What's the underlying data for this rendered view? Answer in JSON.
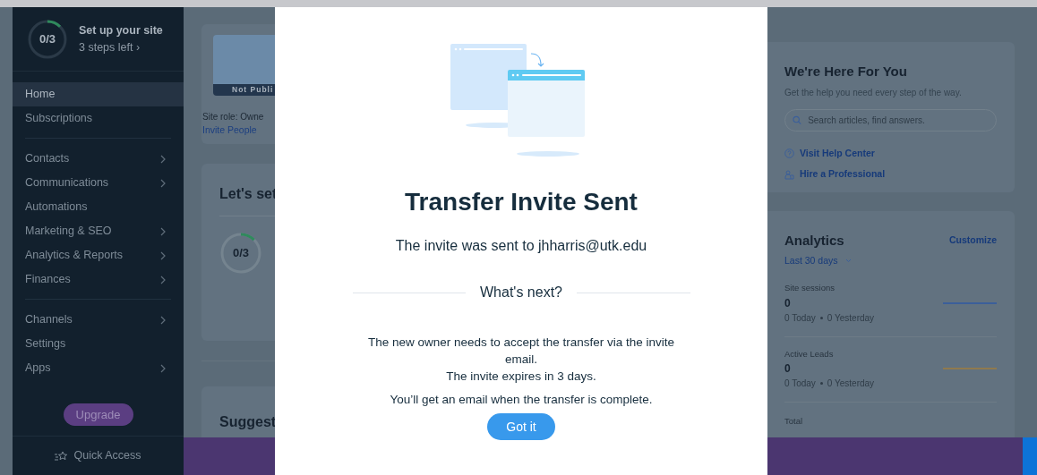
{
  "sidebar": {
    "setup": {
      "progress": "0/3",
      "title": "Set up your site",
      "subtitle": "3 steps left ›"
    },
    "groups": [
      {
        "items": [
          {
            "label": "Home",
            "selected": true,
            "expandable": false
          },
          {
            "label": "Subscriptions",
            "selected": false,
            "expandable": false
          }
        ]
      },
      {
        "items": [
          {
            "label": "Contacts",
            "selected": false,
            "expandable": true
          },
          {
            "label": "Communications",
            "selected": false,
            "expandable": true
          },
          {
            "label": "Automations",
            "selected": false,
            "expandable": false
          },
          {
            "label": "Marketing & SEO",
            "selected": false,
            "expandable": true
          },
          {
            "label": "Analytics & Reports",
            "selected": false,
            "expandable": true
          },
          {
            "label": "Finances",
            "selected": false,
            "expandable": true
          }
        ]
      },
      {
        "items": [
          {
            "label": "Channels",
            "selected": false,
            "expandable": true
          },
          {
            "label": "Settings",
            "selected": false,
            "expandable": false
          },
          {
            "label": "Apps",
            "selected": false,
            "expandable": true
          }
        ]
      }
    ],
    "upgrade_button": "Upgrade",
    "quick_access": "Quick Access"
  },
  "site_card": {
    "status": "Not Publi",
    "role": "Site role: Owne",
    "link": "Invite People"
  },
  "setup_card": {
    "title": "Let's set",
    "progress": "0/3"
  },
  "suggest_card": {
    "title": "Suggest"
  },
  "help_card": {
    "title": "We're Here For You",
    "subtitle": "Get the help you need every step of the way.",
    "search": {
      "placeholder": "Search articles, find answers."
    },
    "links": [
      {
        "kind": "help",
        "label": "Visit Help Center"
      },
      {
        "kind": "professional",
        "label": "Hire a Professional"
      }
    ]
  },
  "analytics_card": {
    "title": "Analytics",
    "action": "Customize",
    "period": "Last 30 days",
    "metrics": [
      {
        "name": "Site sessions",
        "value": "0",
        "today": "0 Today",
        "yesterday": "0 Yesterday",
        "color": "#3b5f9a"
      },
      {
        "name": "Active Leads",
        "value": "0",
        "today": "0 Today",
        "yesterday": "0 Yesterday",
        "color": "#8f7a4e"
      }
    ],
    "footer": "Total"
  },
  "dialog": {
    "title": "Transfer Invite Sent",
    "message": "The invite was sent to jhharris@utk.edu",
    "section": "What's next?",
    "paragraphs": [
      "The new owner needs to accept the transfer via the invite email.",
      "The invite expires in 3 days.",
      "You’ll get an email when the transfer is complete."
    ],
    "button": "Got it"
  }
}
